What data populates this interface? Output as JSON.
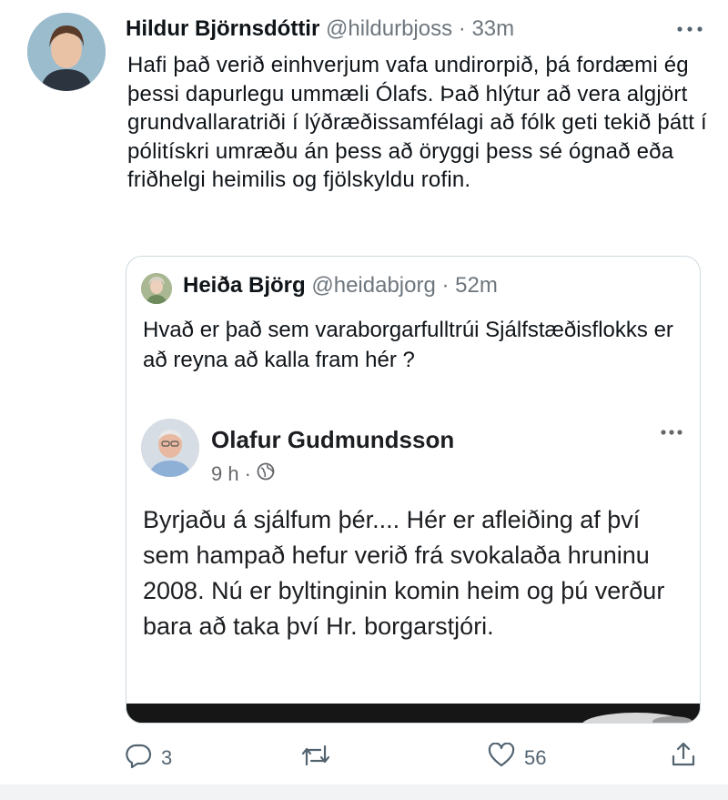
{
  "tweet": {
    "author_name": "Hildur Björnsdóttir",
    "handle": "@hildurbjoss",
    "separator": "·",
    "time": "33m",
    "text": "Hafi það verið einhverjum vafa undirorpið, þá fordæmi ég þessi dapurlegu ummæli Ólafs. Það hlýtur að vera algjört grundvallaratriði í lýðræðissamfélagi að fólk geti tekið þátt í pólitískri umræðu án þess að öryggi þess sé ógnað eða friðhelgi heimilis og fjölskyldu rofin."
  },
  "quote": {
    "author_name": "Heiða Björg",
    "handle": "@heidabjorg",
    "separator": "·",
    "time": "52m",
    "text": "Hvað er það sem varaborgarfulltrúi Sjálfstæðisflokks er að reyna að kalla fram hér ?"
  },
  "facebook_post": {
    "author_name": "Olafur Gudmundsson",
    "time": "9 h",
    "separator": "·",
    "text": "Byrjaðu á sjálfum þér....  Hér er afleiðing af því sem hampað hefur verið frá svokalaða hruninu 2008.  Nú er byltinginin komin heim og þú verður bara að taka því Hr. borgarstjóri."
  },
  "actions": {
    "reply_count": "3",
    "retweet_count": "",
    "like_count": "56"
  },
  "icons": {
    "more": "more-horizontal-icon",
    "reply": "reply-bubble-icon",
    "retweet": "retweet-icon",
    "like": "heart-icon",
    "share": "share-upload-icon",
    "globe": "globe-icon"
  },
  "colors": {
    "text": "#0f1419",
    "muted": "#536471",
    "border": "#cfd9de",
    "facebook_text": "#1c1e21"
  }
}
